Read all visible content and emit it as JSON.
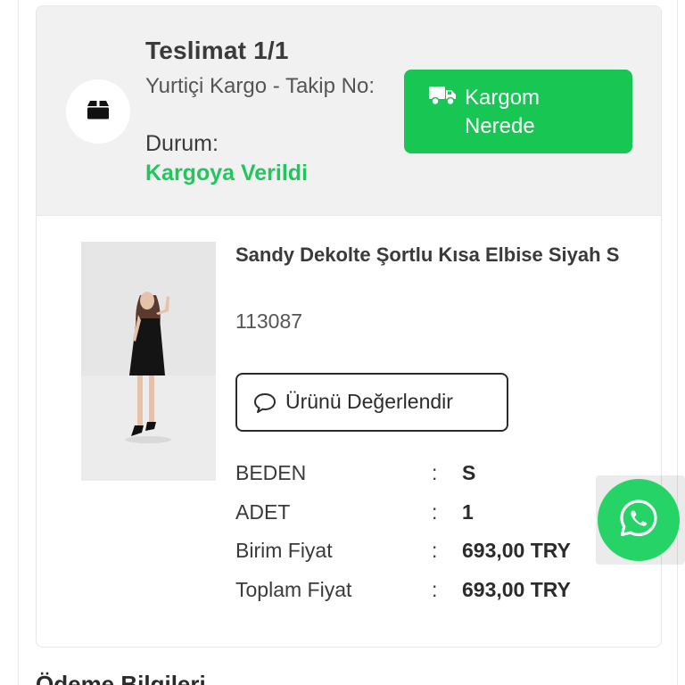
{
  "delivery": {
    "title": "Teslimat 1/1",
    "carrier": "Yurtiçi Kargo - Takip No:",
    "status_label": "Durum:",
    "status_value": "Kargoya Verildi",
    "track_button_label": "Kargom Nerede",
    "status_color": "#22c55e",
    "button_color": "#17c653"
  },
  "icons": {
    "package": "package-icon",
    "truck": "truck-icon",
    "chat": "chat-bubble-icon",
    "whatsapp": "whatsapp-icon"
  },
  "product": {
    "name": "Sandy Dekolte Şortlu Kısa Elbise Siyah S",
    "code": "113087",
    "review_button_label": "Ürünü Değerlendir",
    "details": [
      {
        "label": "BEDEN",
        "separator": ":",
        "value": "S"
      },
      {
        "label": "ADET",
        "separator": ":",
        "value": "1"
      },
      {
        "label": "Birim Fiyat",
        "separator": ":",
        "value": "693,00 TRY"
      },
      {
        "label": "Toplam Fiyat",
        "separator": ":",
        "value": "693,00 TRY"
      }
    ]
  },
  "payment": {
    "heading": "Ödeme Bilgileri"
  }
}
